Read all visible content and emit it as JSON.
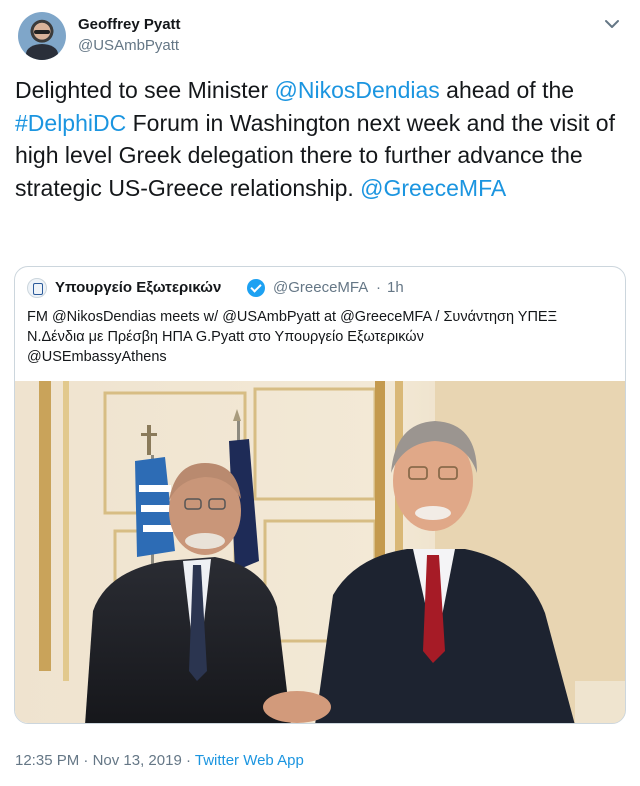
{
  "author": {
    "name": "Geoffrey Pyatt",
    "handle": "@USAmbPyatt"
  },
  "tweet": {
    "segments": [
      {
        "text": "Delighted to see Minister ",
        "type": "text"
      },
      {
        "text": "@NikosDendias",
        "type": "mention"
      },
      {
        "text": " ahead of the ",
        "type": "text"
      },
      {
        "text": "#DelphiDC",
        "type": "mention"
      },
      {
        "text": " Forum in Washington next week and the visit of high level Greek delegation there to further advance the strategic US-Greece relationship. ",
        "type": "text"
      },
      {
        "text": "@GreeceMFA",
        "type": "mention"
      }
    ]
  },
  "quoted": {
    "name": "Υπουργείο Εξωτερικών",
    "handle": "@GreeceMFA",
    "separator": "·",
    "time": "1h",
    "text_line1": "FM @NikosDendias meets w/ @USAmbPyatt at @GreeceMFA / Συνάντηση ΥΠΕΞ",
    "text_line2": "Ν.Δένδια με Πρέσβη ΗΠΑ G.Pyatt στο Υπουργείο Εξωτερικών",
    "text_line3": "@USEmbassyAthens"
  },
  "footer": {
    "time": "12:35 PM",
    "sep1": " · ",
    "date": "Nov 13, 2019",
    "sep2": " · ",
    "app": "Twitter Web App"
  },
  "colors": {
    "link": "#1b95e0",
    "muted": "#657786",
    "text": "#14171a",
    "verified": "#1da1f2"
  }
}
